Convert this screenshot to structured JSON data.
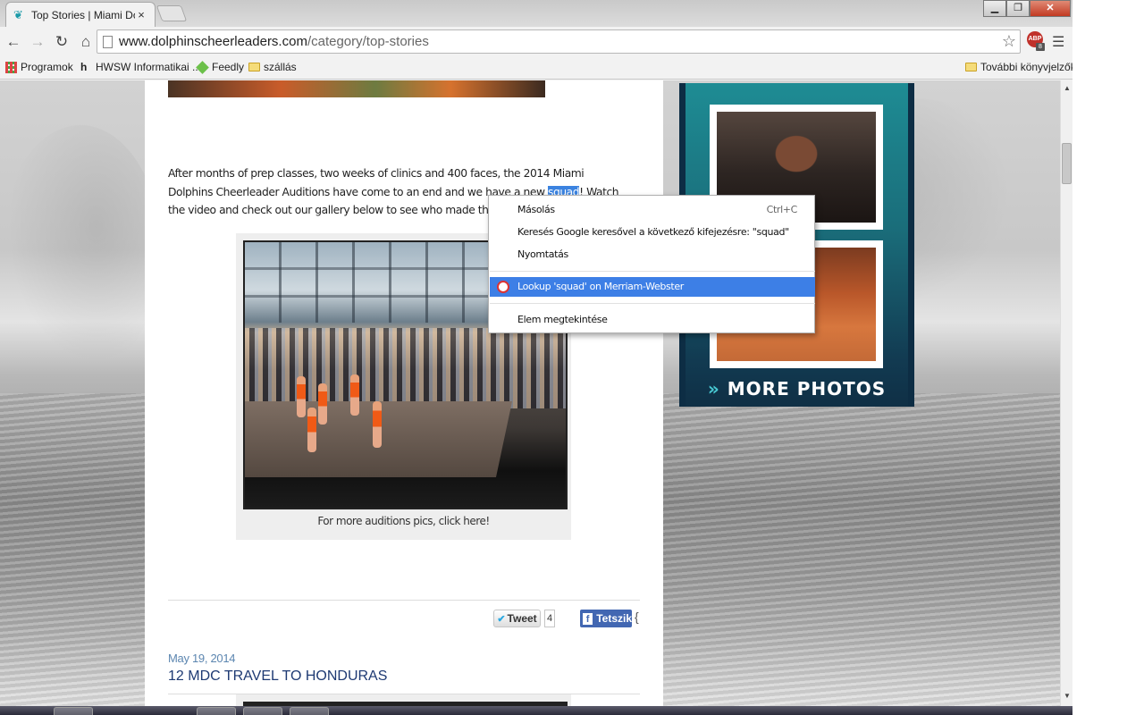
{
  "browser": {
    "tab_title": "Top Stories | Miami Dolph",
    "tab_close": "×",
    "url_host": "www.dolphinscheerleaders.com",
    "url_path": "/category/top-stories",
    "abp_label": "ABP",
    "abp_count": "8"
  },
  "bookmarks": [
    {
      "label": "Programok",
      "icon": "apps-icon"
    },
    {
      "label": "HWSW Informatikai ...",
      "icon": "hwsw-icon"
    },
    {
      "label": "Feedly",
      "icon": "feedly-icon"
    },
    {
      "label": "szállás",
      "icon": "folder-icon"
    }
  ],
  "bookmarks_other": "További könyvjelzők",
  "article": {
    "text_before": "After months of prep classes, two weeks of clinics and 400 faces, the 2014 Miami Dolphins Cheerleader Auditions have come to an end and we have a new ",
    "selected_word": "squad",
    "text_after": "! Watch the video and check out our gallery below to see who made the cut!",
    "caption": "For more auditions pics, click here!"
  },
  "social": {
    "tweet_label": "Tweet",
    "tweet_count": "4",
    "fb_label": "Tetszik"
  },
  "next_post": {
    "date": "May 19, 2014",
    "title": "12 MDC TRAVEL TO HONDURAS"
  },
  "sidebar": {
    "more_photos": "MORE PHOTOS",
    "arrow": "»"
  },
  "context_menu": {
    "copy": "Másolás",
    "copy_shortcut": "Ctrl+C",
    "search": "Keresés Google keresővel a következő kifejezésre: \"squad\"",
    "print": "Nyomtatás",
    "lookup": "Lookup 'squad' on Merriam-Webster",
    "inspect": "Elem megtekintése"
  }
}
